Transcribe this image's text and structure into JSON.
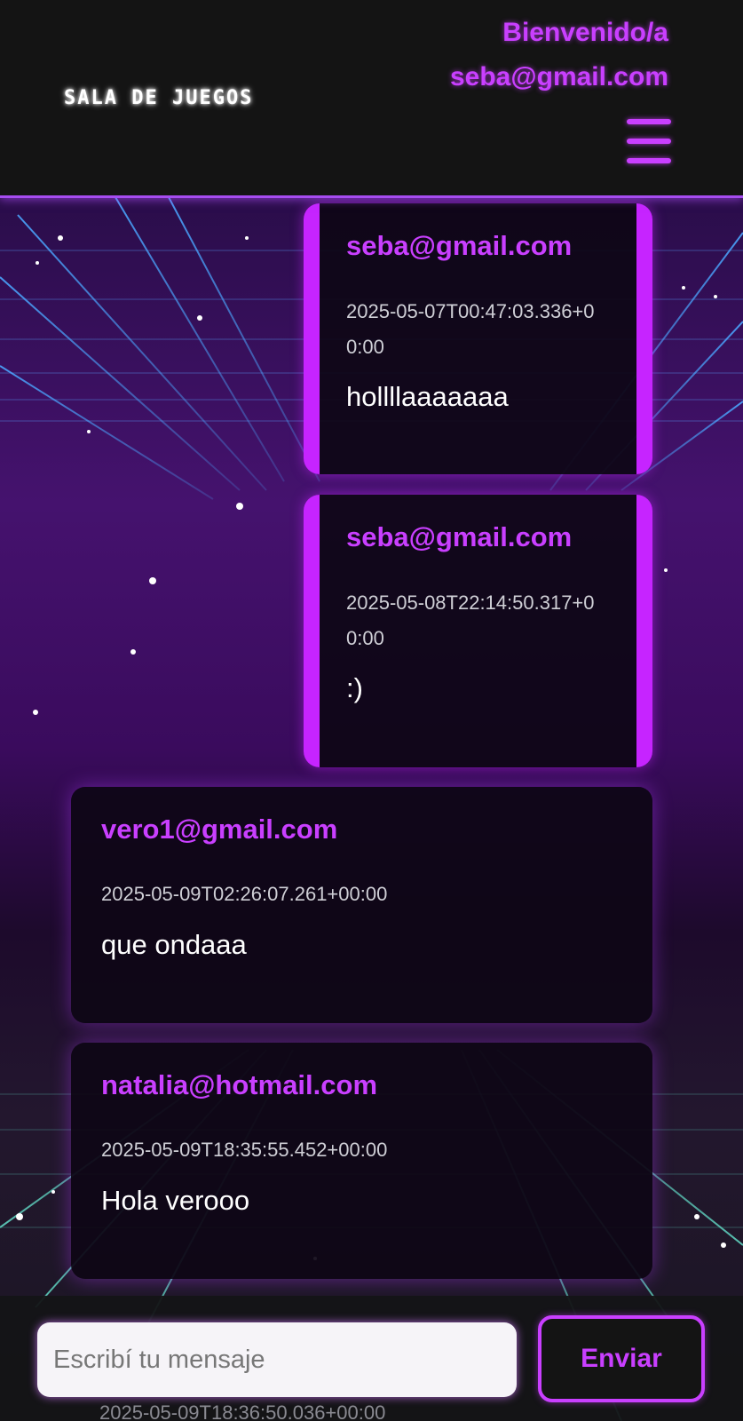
{
  "header": {
    "logo": "SALA DE JUEGOS",
    "welcome_label": "Bienvenido/a",
    "user_email": "seba@gmail.com",
    "menu_icon": "hamburger-menu-icon"
  },
  "messages": [
    {
      "author": "seba@gmail.com",
      "timestamp": "2025-05-07T00:47:03.336+00:00",
      "text": "hollllaaaaaaa"
    },
    {
      "author": "seba@gmail.com",
      "timestamp": "2025-05-08T22:14:50.317+00:00",
      "text": ":)"
    },
    {
      "author": "vero1@gmail.com",
      "timestamp": "2025-05-09T02:26:07.261+00:00",
      "text": "que ondaaa"
    },
    {
      "author": "natalia@hotmail.com",
      "timestamp": "2025-05-09T18:35:55.452+00:00",
      "text": "Hola verooo"
    },
    {
      "timestamp": "2025-05-09T18:36:50.036+00:00"
    }
  ],
  "composer": {
    "placeholder": "Escribí tu mensaje",
    "send_label": "Enviar"
  },
  "colors": {
    "accent": "#c93fff",
    "header_bg": "#141414"
  }
}
